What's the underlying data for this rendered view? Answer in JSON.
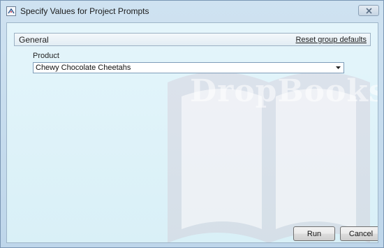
{
  "window": {
    "title": "Specify Values for Project Prompts",
    "icon": "app-icon",
    "close_icon": "close-icon"
  },
  "group": {
    "title": "General",
    "reset_label": "Reset group defaults"
  },
  "prompt": {
    "label": "Product",
    "selected_value": "Chewy Chocolate Cheetahs"
  },
  "buttons": {
    "run_label": "Run",
    "cancel_label": "Cancel"
  },
  "watermark": {
    "text": "DropBooks"
  },
  "colors": {
    "client_background": "#dff3f9",
    "frame": "#c9dced",
    "watermark": "#c7a3b8"
  }
}
